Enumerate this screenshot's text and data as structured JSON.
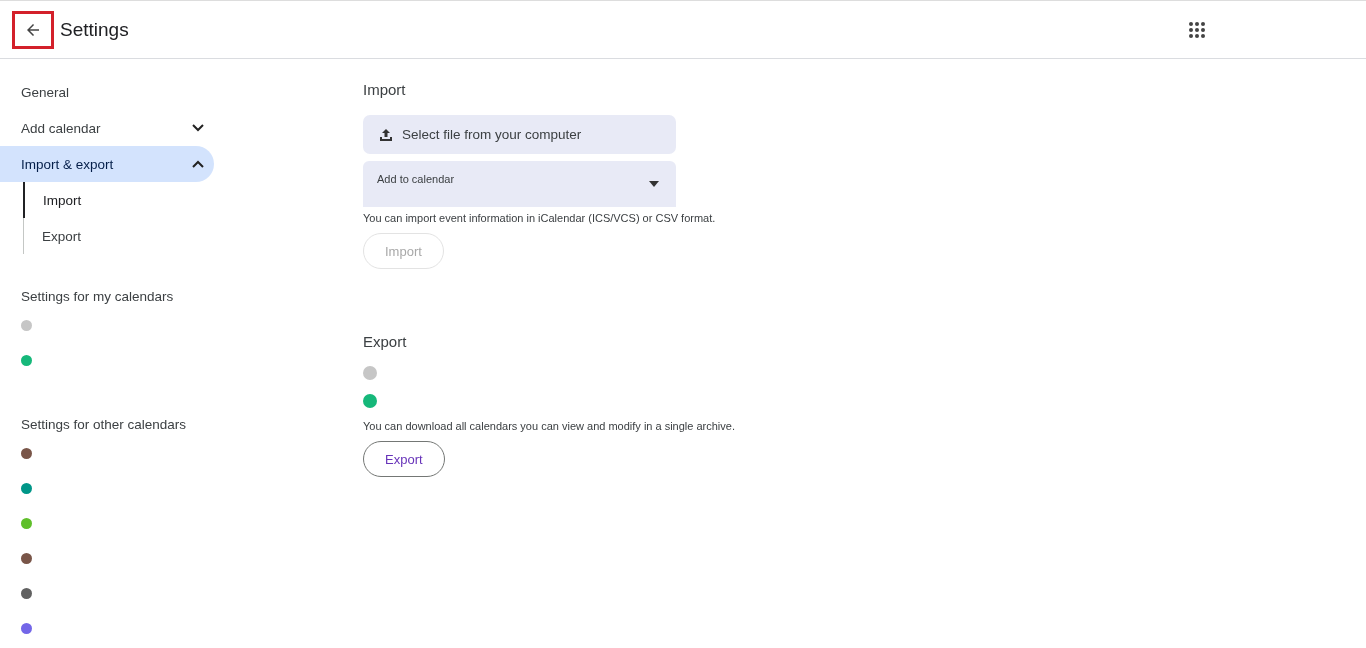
{
  "header": {
    "title": "Settings",
    "back_highlighted": true
  },
  "sidebar": {
    "items": [
      {
        "label": "General",
        "selected": false
      },
      {
        "label": "Add calendar",
        "selected": false,
        "expanded": false
      },
      {
        "label": "Import & export",
        "selected": true,
        "expanded": true,
        "children": [
          {
            "label": "Import",
            "selected": true
          },
          {
            "label": "Export",
            "selected": false
          }
        ]
      }
    ],
    "my_calendars": {
      "heading": "Settings for my calendars",
      "items": [
        {
          "color": "#c6c6c6"
        },
        {
          "color": "#16b87a"
        }
      ]
    },
    "other_calendars": {
      "heading": "Settings for other calendars",
      "items": [
        {
          "color": "#795548"
        },
        {
          "color": "#009688"
        },
        {
          "color": "#5fbf2a"
        },
        {
          "color": "#795548"
        },
        {
          "color": "#616161"
        },
        {
          "color": "#7366e8"
        }
      ]
    }
  },
  "import": {
    "heading": "Import",
    "file_button": "Select file from your computer",
    "calendar_field": {
      "label": "Add to calendar"
    },
    "hint": "You can import event information in iCalendar (ICS/VCS) or CSV format.",
    "button": {
      "label": "Import",
      "disabled": true
    }
  },
  "export": {
    "heading": "Export",
    "calendars": [
      {
        "color": "#c6c6c6"
      },
      {
        "color": "#16b87a"
      }
    ],
    "hint": "You can download all calendars you can view and modify in a single archive.",
    "button": {
      "label": "Export",
      "disabled": false
    }
  }
}
